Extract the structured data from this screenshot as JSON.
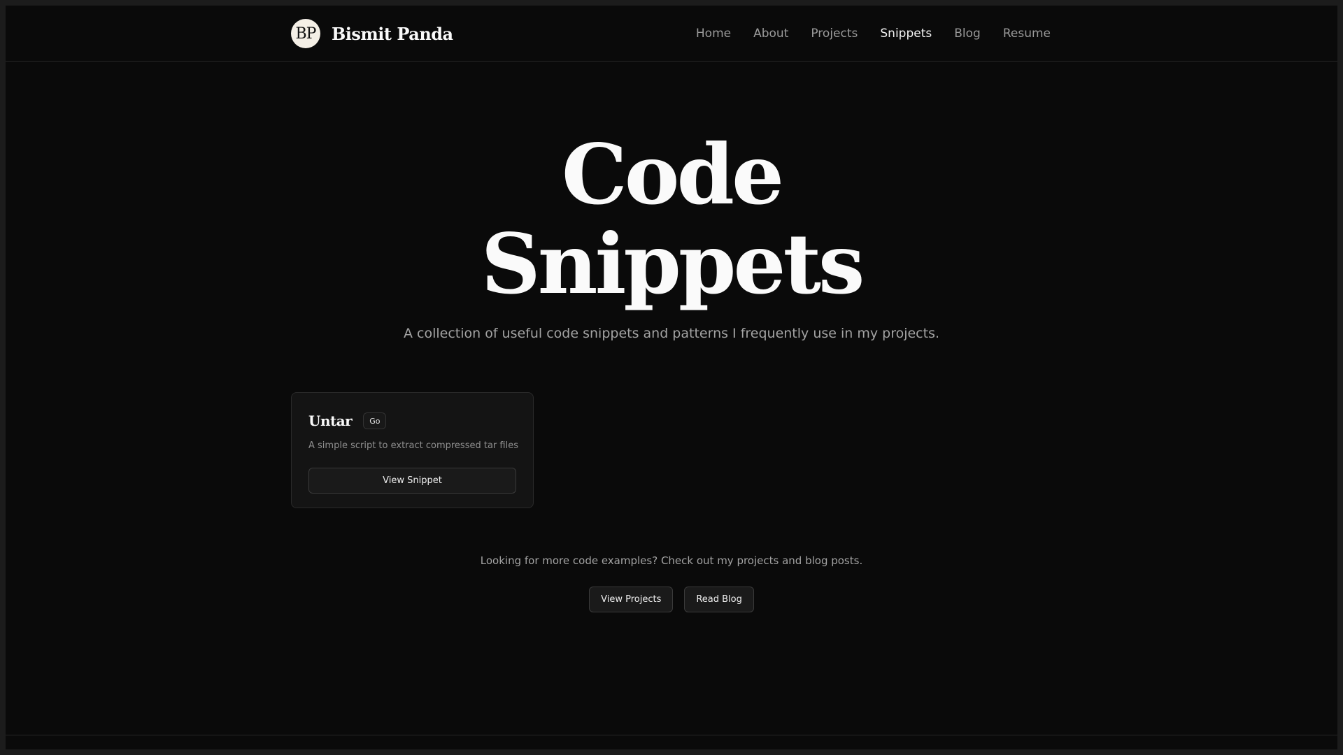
{
  "brand": {
    "logo_text": "BP",
    "name": "Bismit Panda"
  },
  "nav": {
    "items": [
      {
        "label": "Home"
      },
      {
        "label": "About"
      },
      {
        "label": "Projects"
      },
      {
        "label": "Snippets",
        "active": true
      },
      {
        "label": "Blog"
      },
      {
        "label": "Resume"
      }
    ]
  },
  "hero": {
    "title_line1": "Code",
    "title_line2": "Snippets",
    "subtitle": "A collection of useful code snippets and patterns I frequently use in my projects."
  },
  "snippets": [
    {
      "title": "Untar",
      "language": "Go",
      "description": "A simple script to extract compressed tar files",
      "button_label": "View Snippet"
    }
  ],
  "cta": {
    "text": "Looking for more code examples? Check out my projects and blog posts.",
    "projects_button": "View Projects",
    "blog_button": "Read Blog"
  },
  "colors": {
    "background": "#0a0a0a",
    "text_primary": "#fafafa",
    "text_muted": "#a3a3a3",
    "border": "#2a2a2a"
  }
}
